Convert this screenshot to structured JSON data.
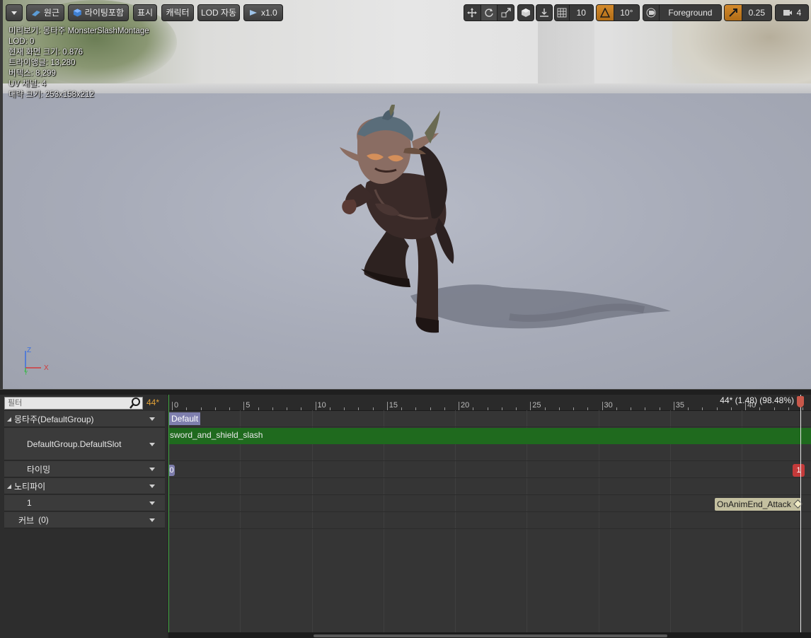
{
  "toolbar": {
    "perspective_label": "원근",
    "lighting_label": "라이팅포함",
    "show_label": "표시",
    "character_label": "캐릭터",
    "lod_label": "LOD 자동",
    "speed_label": "x1.0",
    "grid_snap_value": "10",
    "rotation_snap_value": "10°",
    "layer_label": "Foreground",
    "scale_snap_value": "0.25",
    "camera_speed_value": "4",
    "accent_color": "#c8842a"
  },
  "stats": {
    "preview": "미리보기: 몽타주 MonsterSlashMontage",
    "lod": "LOD: 0",
    "screen_size": "현재 화면 크기: 0.876",
    "triangles": "트라이앵글: 13,280",
    "vertices": "버텍스: 8,299",
    "uv_channels": "UV 채널: 4",
    "approx_size": "대략 크기: 253x158x212"
  },
  "gizmo": {
    "z": "Z",
    "y": "Y",
    "x": "X"
  },
  "left_panel": {
    "filter_placeholder": "필터",
    "current_frame": "44*",
    "tracks": [
      {
        "label": "몽타주(DefaultGroup)"
      },
      {
        "label": "DefaultGroup.DefaultSlot"
      },
      {
        "label": "타이밍"
      },
      {
        "label": "노티파이"
      },
      {
        "label": "1"
      },
      {
        "label": "커브",
        "count": "(0)"
      }
    ]
  },
  "timeline": {
    "ticks": [
      "0",
      "5",
      "10",
      "15",
      "20",
      "25",
      "30",
      "35",
      "40"
    ],
    "time_readout": "44* (1.48) (98.48%)",
    "section_label": "Default",
    "segment_label": "sword_and_shield_slash",
    "marker_start": "0",
    "marker_end": "1",
    "notify_label": "OnAnimEnd_Attack"
  }
}
